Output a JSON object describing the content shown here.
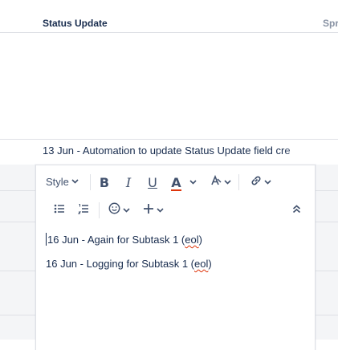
{
  "table": {
    "header_status": "Status Update",
    "header_next": "Spr"
  },
  "previous_row": {
    "text": "13 Jun - Automation to update Status Update field cre"
  },
  "toolbar": {
    "style_label": "Style",
    "bold": "B",
    "italic": "I",
    "underline": "U",
    "text_color": "A",
    "text_color_accent": "#de350b"
  },
  "editor": {
    "lines": [
      {
        "prefix": "16 Jun - Again for Subtask 1 (",
        "eol": "eol",
        "suffix": ")"
      },
      {
        "prefix": "16 Jun - Logging for Subtask 1 (",
        "eol": "eol",
        "suffix": ")"
      }
    ]
  }
}
